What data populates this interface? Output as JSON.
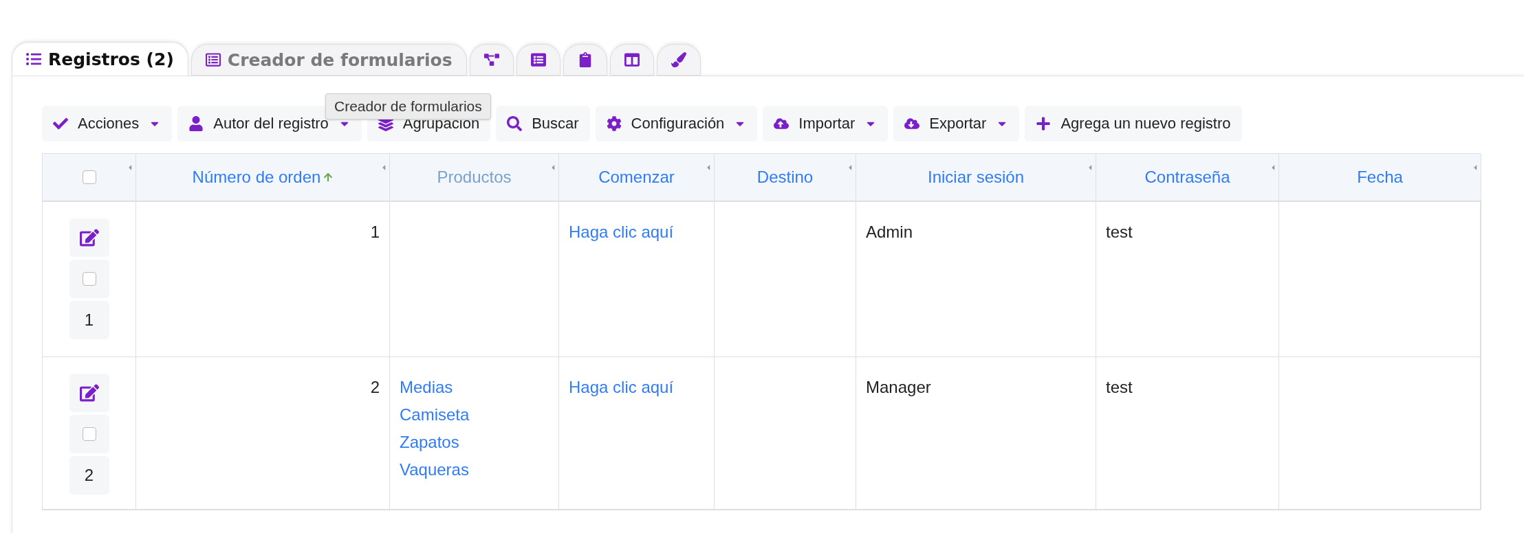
{
  "tabs": [
    {
      "label": "Registros (2)",
      "selected": true
    },
    {
      "label": "Creador de formularios",
      "selected": false
    },
    {
      "selected": false
    },
    {
      "selected": false
    },
    {
      "selected": false
    },
    {
      "selected": false
    },
    {
      "selected": false
    }
  ],
  "tooltip": "Creador de formularios",
  "toolbar": [
    {
      "label": "Acciones",
      "dropdown": true
    },
    {
      "label": "Autor del registro",
      "dropdown": true
    },
    {
      "label": "Agrupación",
      "dropdown": false
    },
    {
      "label": "Buscar",
      "dropdown": false
    },
    {
      "label": "Configuración",
      "dropdown": true
    },
    {
      "label": "Importar",
      "dropdown": true
    },
    {
      "label": "Exportar",
      "dropdown": true
    },
    {
      "label": "Agrega un nuevo registro",
      "dropdown": false
    }
  ],
  "table": {
    "select_all": {
      "checked": false
    },
    "columns": [
      {
        "label": "Número de orden",
        "sortable": true,
        "sorted": true
      },
      {
        "label": "Productos",
        "sortable": false,
        "sorted": false
      },
      {
        "label": "Comenzar",
        "sortable": true,
        "sorted": false
      },
      {
        "label": "Destino",
        "sortable": true,
        "sorted": false
      },
      {
        "label": "Iniciar sesión",
        "sortable": true,
        "sorted": false
      },
      {
        "label": "Contraseña",
        "sortable": true,
        "sorted": false
      },
      {
        "label": "Fecha",
        "sortable": true,
        "sorted": false
      }
    ],
    "rows": [
      {
        "number": "1",
        "checked": false,
        "cells": [
          {
            "kind": "number",
            "text": "1"
          },
          {
            "kind": "empty"
          },
          {
            "kind": "link",
            "text": "Haga clic aquí"
          },
          {
            "kind": "empty"
          },
          {
            "kind": "text",
            "text": "Admin"
          },
          {
            "kind": "text",
            "text": "test"
          },
          {
            "kind": "empty"
          }
        ]
      },
      {
        "number": "2",
        "checked": false,
        "cells": [
          {
            "kind": "number",
            "text": "2"
          },
          {
            "kind": "links",
            "items": [
              "Medias",
              "Camiseta",
              "Zapatos",
              "Vaqueras"
            ]
          },
          {
            "kind": "link",
            "text": "Haga clic aquí"
          },
          {
            "kind": "empty"
          },
          {
            "kind": "text",
            "text": "Manager"
          },
          {
            "kind": "text",
            "text": "test"
          },
          {
            "kind": "empty"
          }
        ]
      }
    ]
  }
}
